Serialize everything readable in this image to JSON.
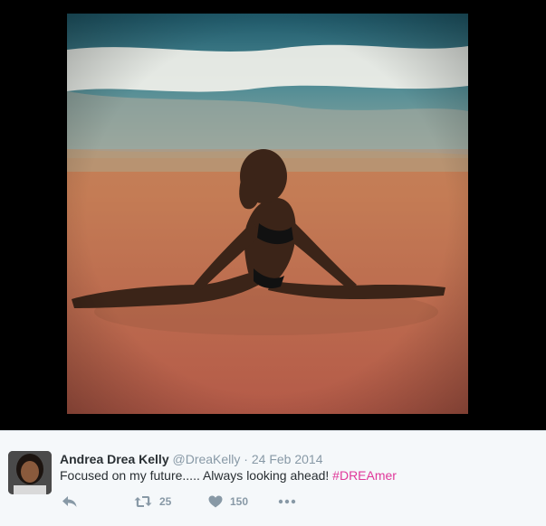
{
  "media": {
    "icon": "beach-photo"
  },
  "tweet": {
    "author_name": "Andrea Drea Kelly",
    "handle": "@DreaKelly",
    "separator": "·",
    "date": "24 Feb 2014",
    "text": "Focused on my future..... Always looking ahead! ",
    "hashtag": "#DREAmer",
    "hashtag_color": "#e0389a",
    "retweet_count": "25",
    "like_count": "150"
  },
  "icons": {
    "reply": "reply-icon",
    "retweet": "retweet-icon",
    "like": "heart-icon",
    "more": "more-icon"
  }
}
